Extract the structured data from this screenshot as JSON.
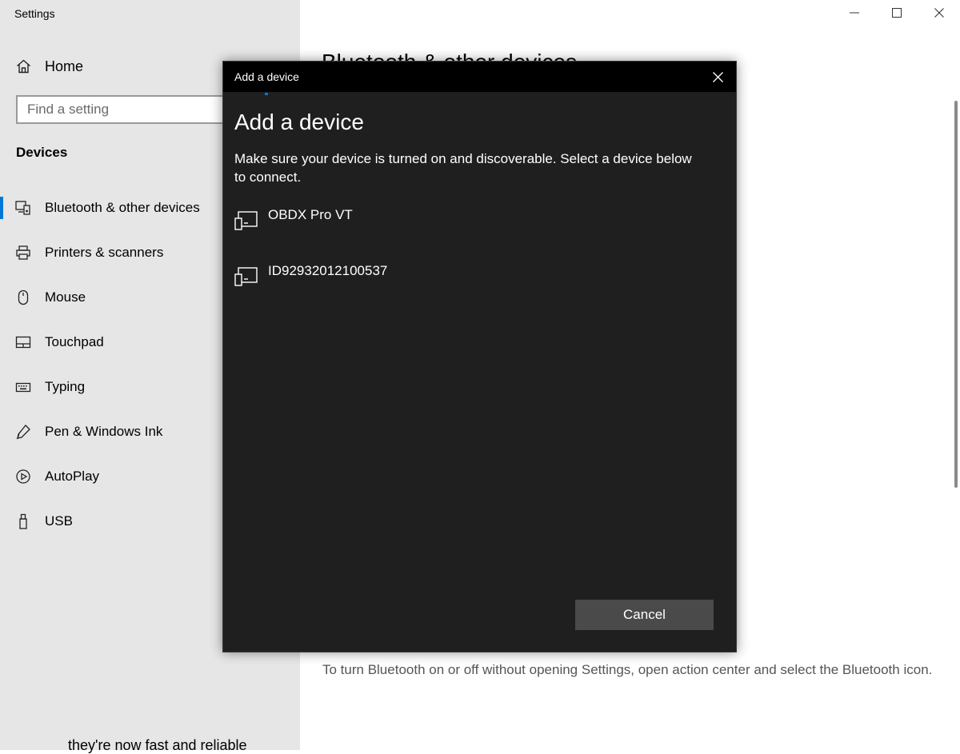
{
  "window": {
    "title": "Settings"
  },
  "sidebar": {
    "home_label": "Home",
    "search_placeholder": "Find a setting",
    "section_title": "Devices",
    "items": [
      {
        "label": "Bluetooth & other devices",
        "icon": "bluetooth-devices-icon",
        "active": true
      },
      {
        "label": "Printers & scanners",
        "icon": "printer-icon",
        "active": false
      },
      {
        "label": "Mouse",
        "icon": "mouse-icon",
        "active": false
      },
      {
        "label": "Touchpad",
        "icon": "touchpad-icon",
        "active": false
      },
      {
        "label": "Typing",
        "icon": "keyboard-icon",
        "active": false
      },
      {
        "label": "Pen & Windows Ink",
        "icon": "pen-icon",
        "active": false
      },
      {
        "label": "AutoPlay",
        "icon": "autoplay-icon",
        "active": false
      },
      {
        "label": "USB",
        "icon": "usb-icon",
        "active": false
      }
    ]
  },
  "main": {
    "heading": "Bluetooth & other devices",
    "tip_text": "To turn Bluetooth on or off without opening Settings, open action center and select the Bluetooth icon.",
    "bottom_partial_text": "they're now fast and reliable"
  },
  "dialog": {
    "title_bar": "Add a device",
    "heading": "Add a device",
    "description": "Make sure your device is turned on and discoverable. Select a device below to connect.",
    "devices": [
      {
        "name": "OBDX Pro VT",
        "icon": "generic-device-icon"
      },
      {
        "name": "ID92932012100537",
        "icon": "generic-device-icon"
      }
    ],
    "cancel_label": "Cancel"
  },
  "colors": {
    "accent": "#0078d7",
    "dialog_bg": "#1f1f1f",
    "sidebar_bg": "#e6e6e6"
  }
}
